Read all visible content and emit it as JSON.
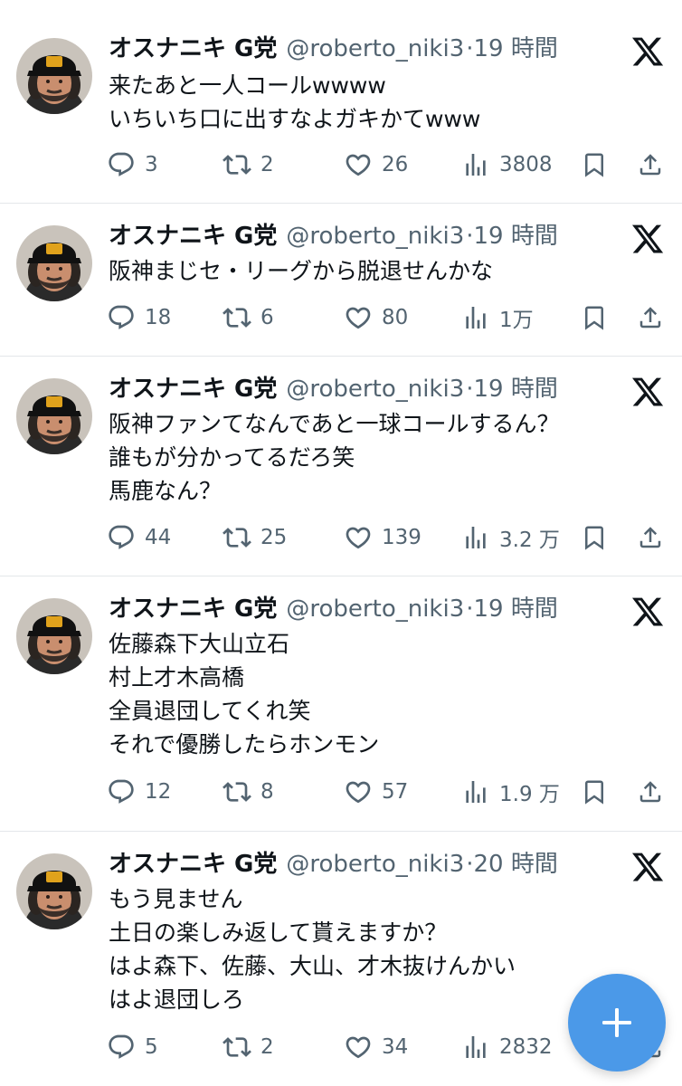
{
  "tweets": [
    {
      "name": "オスナニキ G党",
      "handle": "@roberto_niki3",
      "time": "·19 時間",
      "lines": [
        "来たあと一人コールwwww",
        "いちいち口に出すなよガキかてwww"
      ],
      "replies": "3",
      "retweets": "2",
      "likes": "26",
      "views": "3808"
    },
    {
      "name": "オスナニキ G党",
      "handle": "@roberto_niki3",
      "time": "·19 時間",
      "lines": [
        "阪神まじセ・リーグから脱退せんかな"
      ],
      "replies": "18",
      "retweets": "6",
      "likes": "80",
      "views": "1万"
    },
    {
      "name": "オスナニキ G党",
      "handle": "@roberto_niki3",
      "time": "·19 時間",
      "lines": [
        "阪神ファンてなんであと一球コールするん？",
        "誰もが分かってるだろ笑",
        "馬鹿なん？"
      ],
      "replies": "44",
      "retweets": "25",
      "likes": "139",
      "views": "3.2 万"
    },
    {
      "name": "オスナニキ G党",
      "handle": "@roberto_niki3",
      "time": "·19 時間",
      "lines": [
        "佐藤森下大山立石",
        "村上才木高橋",
        "全員退団してくれ笑",
        "それで優勝したらホンモン"
      ],
      "replies": "12",
      "retweets": "8",
      "likes": "57",
      "views": "1.9 万"
    },
    {
      "name": "オスナニキ G党",
      "handle": "@roberto_niki3",
      "time": "·20 時間",
      "lines": [
        "もう見ません",
        "土日の楽しみ返して貰えますか？",
        "はよ森下、佐藤、大山、才木抜けんかい",
        "はよ退団しろ"
      ],
      "replies": "5",
      "retweets": "2",
      "likes": "34",
      "views": "2832"
    }
  ],
  "icons": {
    "reply": "reply-icon",
    "retweet": "retweet-icon",
    "like": "like-icon",
    "views": "views-icon",
    "bookmark": "bookmark-icon",
    "share": "share-icon",
    "platform": "x-logo-icon",
    "compose": "plus-icon"
  },
  "colors": {
    "text": "#0f1419",
    "secondary": "#536471",
    "divider": "#e4e7ea",
    "fab": "#4b99e8"
  }
}
